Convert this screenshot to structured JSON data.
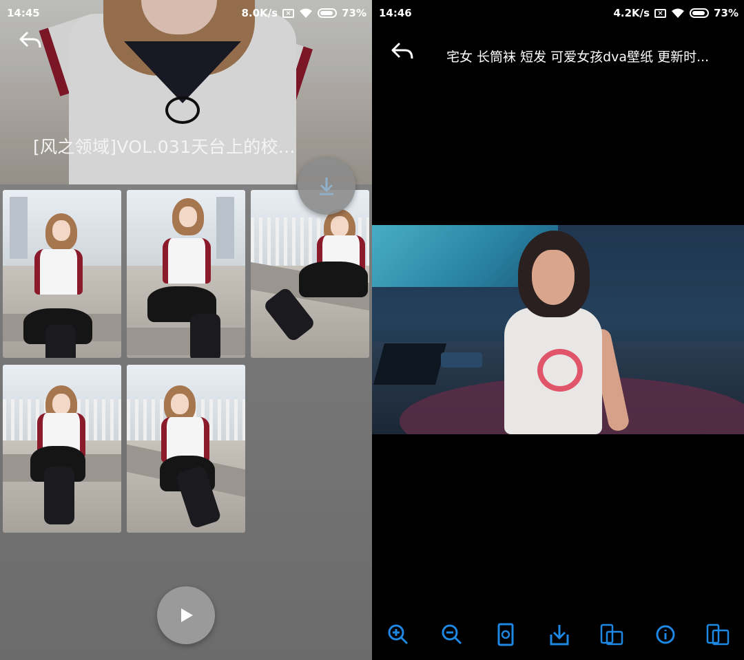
{
  "left_screen": {
    "status_bar": {
      "time": "14:45",
      "net_speed": "8.0K/s",
      "battery": "73%"
    },
    "hero_title": "[风之领域]VOL.031天台上的校...",
    "thumbnails": [
      "photo-1",
      "photo-2",
      "photo-3",
      "photo-4",
      "photo-5"
    ],
    "icons": {
      "back": "back-arrow-icon",
      "download": "download-icon",
      "play": "play-icon"
    }
  },
  "right_screen": {
    "status_bar": {
      "time": "14:46",
      "net_speed": "4.2K/s",
      "battery": "73%"
    },
    "title": "宅女 长筒袜 短发 可爱女孩dva壁纸 更新时...",
    "toolbar": [
      "zoom-in-icon",
      "zoom-out-icon",
      "rotate-screen-icon",
      "download-icon",
      "set-wallpaper-icon",
      "info-icon",
      "set-lockscreen-icon"
    ],
    "colors": {
      "toolbar_accent": "#1e88e5",
      "background": "#000000"
    }
  }
}
